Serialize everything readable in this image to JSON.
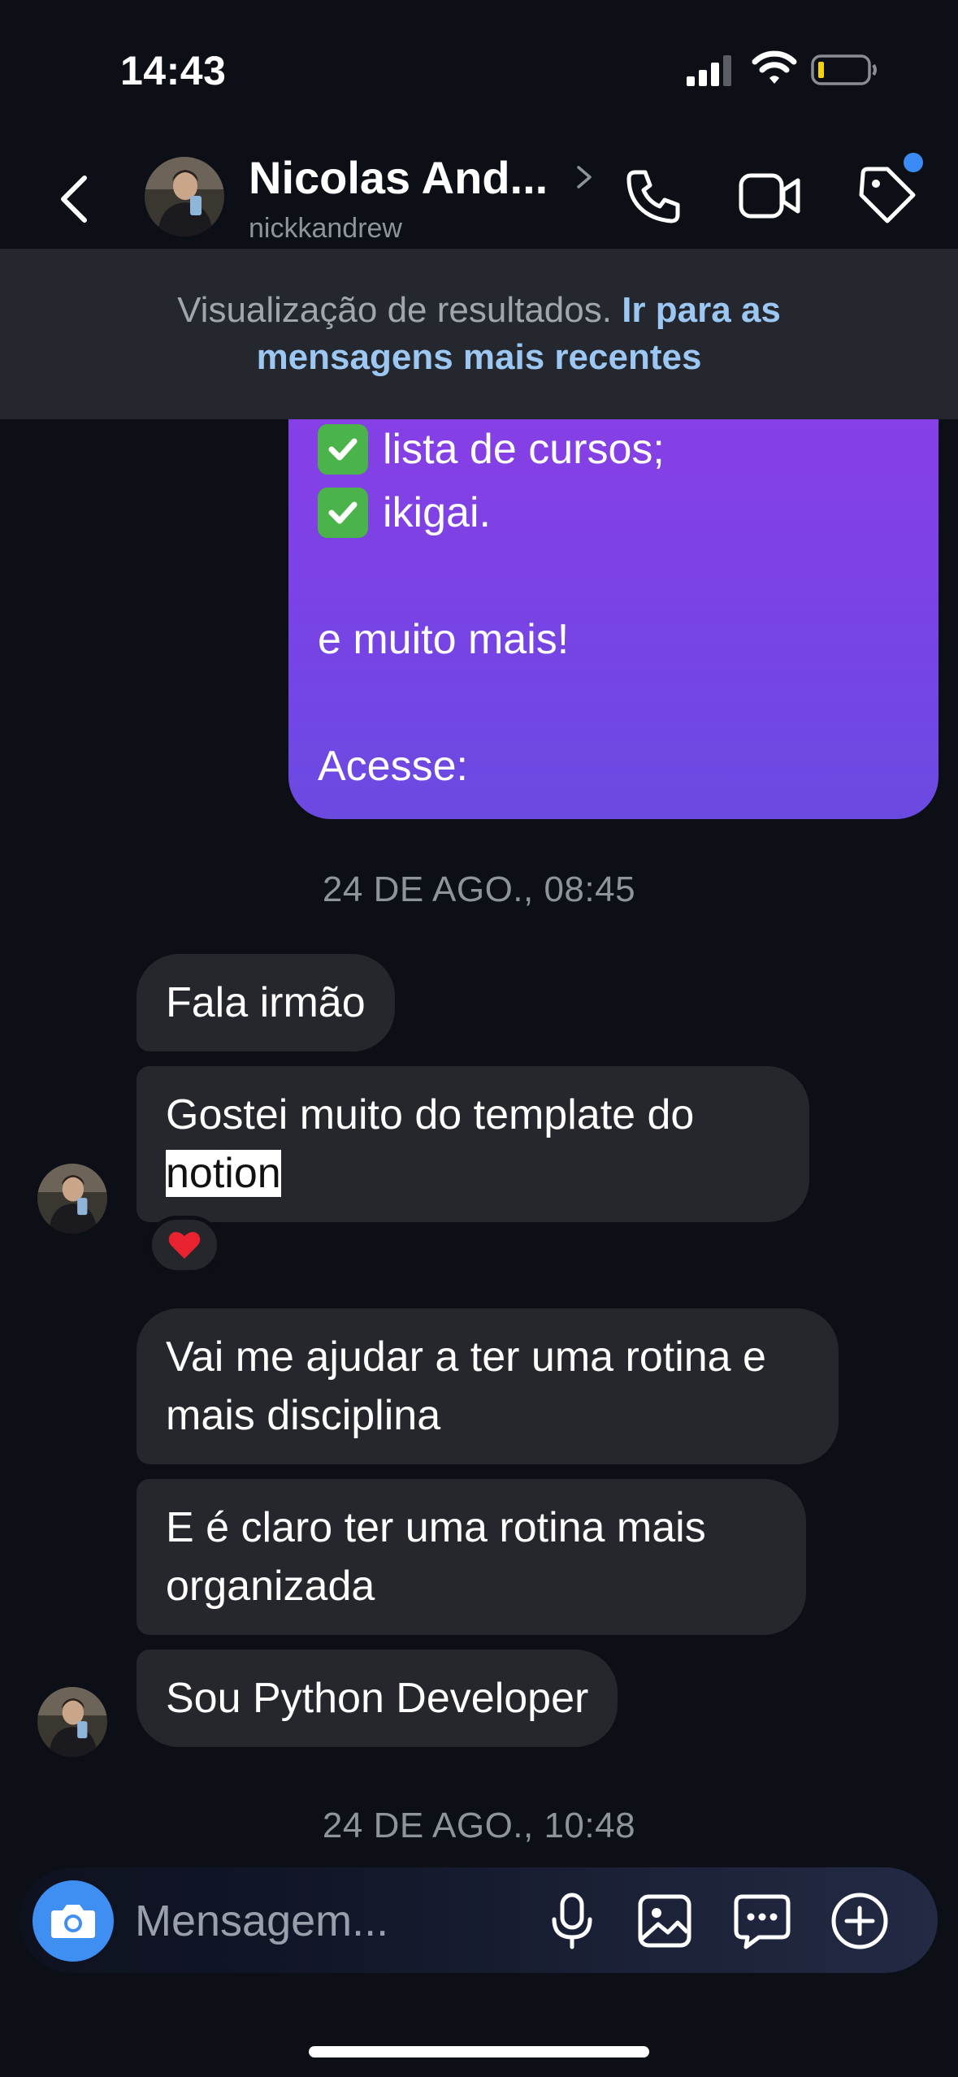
{
  "status_bar": {
    "time": "14:43"
  },
  "header": {
    "contact_name": "Nicolas And...",
    "username": "nickkandrew"
  },
  "banner": {
    "text": "Visualização de resultados.",
    "link": "Ir para as mensagens mais recentes"
  },
  "outgoing": {
    "lines": [
      "lista de cursos;",
      "ikigai.",
      "e muito mais!",
      "Acesse:"
    ]
  },
  "timestamps": [
    "24 DE AGO., 08:45",
    "24 DE AGO., 10:48"
  ],
  "messages": [
    {
      "text": "Fala irmão"
    },
    {
      "text_before": "Gostei muito do template do",
      "highlight": "notion",
      "reaction": "❤"
    },
    {
      "text": "Vai me ajudar a ter uma rotina e mais disciplina"
    },
    {
      "text": "E é claro ter uma rotina mais organizada"
    },
    {
      "text": "Sou Python Developer"
    }
  ],
  "composer": {
    "placeholder": "Mensagem..."
  },
  "colors": {
    "accent_blue": "#3f8ff2",
    "outgoing_bubble": "#7b42e4",
    "incoming_bubble": "#25272d",
    "link": "#9cc7f2"
  },
  "icons": [
    "back-chevron-icon",
    "phone-icon",
    "video-camera-icon",
    "tag-icon",
    "camera-icon",
    "microphone-icon",
    "image-icon",
    "sticker-chat-icon",
    "plus-circle-icon"
  ]
}
